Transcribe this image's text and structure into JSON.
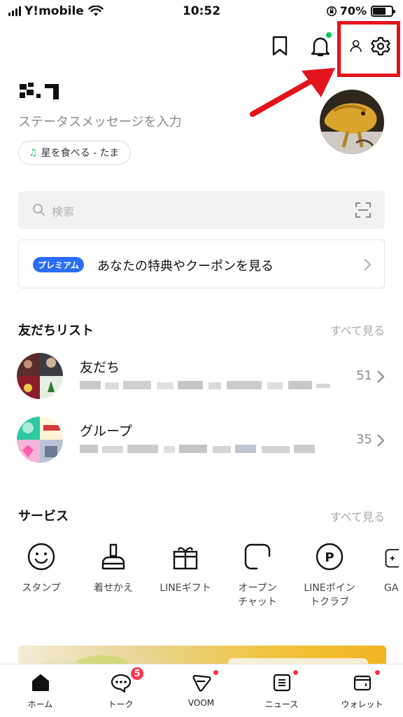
{
  "status_bar": {
    "carrier": "Y!mobile",
    "time": "10:52",
    "battery": "70%",
    "battery_level": 0.7
  },
  "header_icons": [
    "bookmark-icon",
    "bell-icon",
    "add-friend-icon",
    "settings-icon"
  ],
  "annotation": {
    "highlight_color": "#e3131c"
  },
  "profile": {
    "status_placeholder": "ステータスメッセージを入力",
    "music": "星を食べる - たま"
  },
  "search": {
    "placeholder": "検索"
  },
  "premium": {
    "badge": "プレミアム",
    "text": "あなたの特典やクーポンを見る"
  },
  "friends_section": {
    "title": "友だちリスト",
    "see_all": "すべて見る",
    "rows": [
      {
        "title": "友だち",
        "count": "51"
      },
      {
        "title": "グループ",
        "count": "35"
      }
    ]
  },
  "services_section": {
    "title": "サービス",
    "see_all": "すべて見る",
    "items": [
      {
        "label": "スタンプ",
        "icon": "smiley-icon"
      },
      {
        "label": "着せかえ",
        "icon": "brush-icon"
      },
      {
        "label": "LINEギフト",
        "icon": "gift-icon"
      },
      {
        "label": "オープン\nチャット",
        "icon": "open-chat-icon"
      },
      {
        "label": "LINEポイン\nトクラブ",
        "icon": "points-icon"
      },
      {
        "label": "GA",
        "icon": "game-icon"
      }
    ]
  },
  "tabs": [
    {
      "label": "ホーム"
    },
    {
      "label": "トーク",
      "badge": "5"
    },
    {
      "label": "VOOM"
    },
    {
      "label": "ニュース"
    },
    {
      "label": "ウォレット"
    }
  ],
  "colors": {
    "line_green": "#06c755",
    "badge_red": "#ff334b",
    "premium_blue": "#2a6ef5"
  }
}
